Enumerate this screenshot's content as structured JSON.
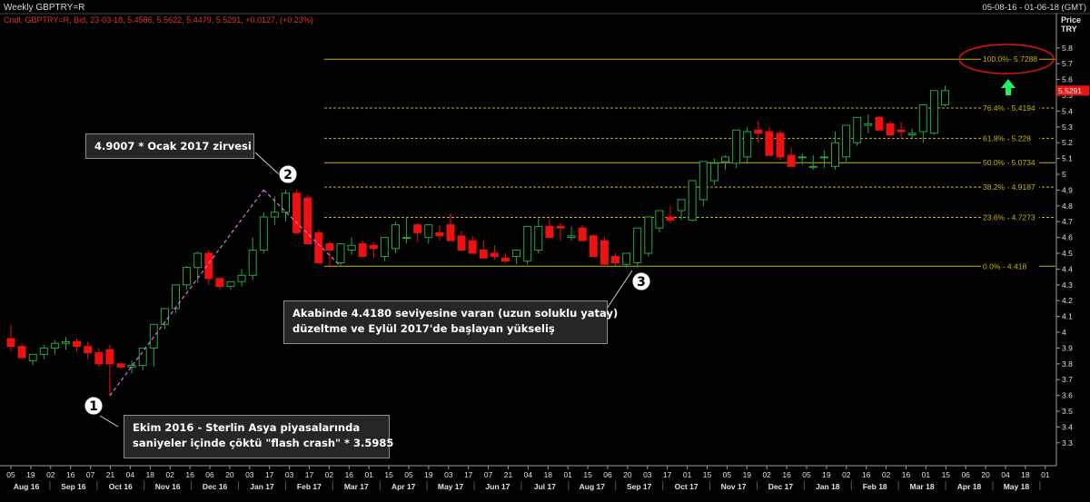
{
  "header": {
    "title": "Weekly GBPTRY=R",
    "date_range": "05-08-16 - 01-06-18 (GMT)",
    "legend_text": "Cndl, GBPTRY=R, Bid, 23-03-18, 5.4586, 5.5622, 5.4479, 5.5291, +0.0127, (+0.23%)",
    "legend_color": "#e2332b",
    "change_color": "#33d0ff"
  },
  "axis": {
    "unit_line1": "Price",
    "unit_line2": "TRY",
    "last_price_label": "5.5291",
    "y_ticks": [
      "5.8",
      "5.7",
      "5.6",
      "5.5",
      "5.4",
      "5.3",
      "5.2",
      "5.1",
      "5",
      "4.9",
      "4.8",
      "4.7",
      "4.6",
      "4.5",
      "4.4",
      "4.3",
      "4.2",
      "4.1",
      "4",
      "3.9",
      "3.8",
      "3.7",
      "3.6",
      "3.5",
      "3.4",
      "3.3"
    ],
    "x_day_ticks": [
      "05",
      "19",
      "02",
      "16",
      "07",
      "21",
      "04",
      "18",
      "02",
      "16",
      "06",
      "20",
      "03",
      "17",
      "03",
      "17",
      "02",
      "16",
      "01",
      "15",
      "05",
      "19",
      "03",
      "17",
      "07",
      "21",
      "04",
      "18",
      "01",
      "15",
      "06",
      "20",
      "03",
      "17",
      "01",
      "15",
      "05",
      "19",
      "02",
      "16",
      "05",
      "19",
      "02",
      "16",
      "02",
      "16",
      "01",
      "15",
      "06",
      "20",
      "04",
      "18",
      "01"
    ],
    "x_month_ticks": [
      "Aug 16",
      "Sep 16",
      "Oct 16",
      "Nov 16",
      "Dec 16",
      "Jan 17",
      "Feb 17",
      "Mar 17",
      "Apr 17",
      "May 17",
      "Jun 17",
      "Jul 17",
      "Aug 17",
      "Sep 17",
      "Oct 17",
      "Nov 17",
      "Dec 17",
      "Jan 18",
      "Feb 18",
      "Mar 18",
      "Apr 18",
      "May 18"
    ]
  },
  "fibonacci": [
    {
      "label": "100.0%- 5.7288"
    },
    {
      "label": "76.4% - 5.4194"
    },
    {
      "label": "61.8% - 5.228"
    },
    {
      "label": "50.0% - 5.0734"
    },
    {
      "label": "38.2% - 4.9187"
    },
    {
      "label": "23.6% - 4.7273"
    },
    {
      "label": "0.0% - 4.418"
    }
  ],
  "markers": [
    "1",
    "2",
    "3"
  ],
  "annotations": {
    "peak_line1": "4.9007 * Ocak 2017 zirvesi",
    "correction_line1": "Akabinde 4.4180 seviyesine varan (uzun soluklu yatay)",
    "correction_line2": "düzeltme ve Eylül 2017'de başlayan yükseliş",
    "crash_line1": "Ekim 2016 - Sterlin Asya piyasalarında",
    "crash_line2": "saniyeler içinde çöktü \"flash crash\" * 3.5985"
  },
  "colors": {
    "background": "#000000",
    "up": "#22a844",
    "down": "#ee1111",
    "fib": "#c8b400",
    "trend": "#e070e0",
    "arrow": "#22ee66",
    "circle": "#ee1111"
  },
  "chart_data": {
    "type": "candlestick",
    "title": "Weekly GBPTRY=R",
    "ylabel": "Price TRY",
    "ylim": [
      3.2,
      5.87
    ],
    "x_range": [
      "2016-08-05",
      "2018-06-01"
    ],
    "series": [
      {
        "name": "GBPTRY=R",
        "x": [
          "2016-08-05",
          "2016-08-12",
          "2016-08-19",
          "2016-08-26",
          "2016-09-02",
          "2016-09-09",
          "2016-09-16",
          "2016-09-23",
          "2016-09-30",
          "2016-10-07",
          "2016-10-14",
          "2016-10-21",
          "2016-10-28",
          "2016-11-04",
          "2016-11-11",
          "2016-11-18",
          "2016-11-25",
          "2016-12-02",
          "2016-12-09",
          "2016-12-16",
          "2016-12-23",
          "2016-12-30",
          "2017-01-06",
          "2017-01-13",
          "2017-01-20",
          "2017-01-27",
          "2017-02-03",
          "2017-02-10",
          "2017-02-17",
          "2017-02-24",
          "2017-03-03",
          "2017-03-10",
          "2017-03-17",
          "2017-03-24",
          "2017-03-31",
          "2017-04-07",
          "2017-04-14",
          "2017-04-21",
          "2017-04-28",
          "2017-05-05",
          "2017-05-12",
          "2017-05-19",
          "2017-05-26",
          "2017-06-02",
          "2017-06-09",
          "2017-06-16",
          "2017-06-23",
          "2017-06-30",
          "2017-07-07",
          "2017-07-14",
          "2017-07-21",
          "2017-07-28",
          "2017-08-04",
          "2017-08-11",
          "2017-08-18",
          "2017-08-25",
          "2017-09-01",
          "2017-09-08",
          "2017-09-15",
          "2017-09-22",
          "2017-09-29",
          "2017-10-06",
          "2017-10-13",
          "2017-10-20",
          "2017-10-27",
          "2017-11-03",
          "2017-11-10",
          "2017-11-17",
          "2017-11-24",
          "2017-12-01",
          "2017-12-08",
          "2017-12-15",
          "2017-12-22",
          "2017-12-29",
          "2018-01-05",
          "2018-01-12",
          "2018-01-19",
          "2018-01-26",
          "2018-02-02",
          "2018-02-09",
          "2018-02-16",
          "2018-02-23",
          "2018-03-02",
          "2018-03-09",
          "2018-03-16",
          "2018-03-23"
        ],
        "open": [
          3.96,
          3.91,
          3.82,
          3.86,
          3.9,
          3.93,
          3.94,
          3.91,
          3.87,
          3.89,
          3.8,
          3.78,
          3.79,
          3.9,
          4.05,
          4.15,
          4.3,
          4.41,
          4.5,
          4.34,
          4.29,
          4.32,
          4.36,
          4.52,
          4.73,
          4.76,
          4.88,
          4.85,
          4.63,
          4.56,
          4.44,
          4.52,
          4.56,
          4.55,
          4.48,
          4.53,
          4.6,
          4.68,
          4.6,
          4.63,
          4.68,
          4.61,
          4.58,
          4.52,
          4.5,
          4.47,
          4.48,
          4.45,
          4.52,
          4.67,
          4.67,
          4.6,
          4.66,
          4.61,
          4.58,
          4.48,
          4.43,
          4.44,
          4.5,
          4.66,
          4.73,
          4.77,
          4.71,
          4.84,
          4.96,
          5.08,
          5.07,
          5.11,
          5.28,
          5.27,
          5.26,
          5.12,
          5.11,
          5.05,
          5.11,
          5.05,
          5.11,
          5.2,
          5.31,
          5.36,
          5.32,
          5.28,
          5.25,
          5.27,
          5.26,
          5.44
        ],
        "high": [
          4.05,
          3.93,
          3.86,
          3.92,
          3.95,
          3.97,
          3.96,
          3.94,
          3.9,
          3.92,
          3.81,
          3.82,
          3.8,
          3.96,
          4.15,
          4.3,
          4.42,
          4.51,
          4.52,
          4.35,
          4.32,
          4.4,
          4.6,
          4.76,
          4.86,
          4.9,
          4.9,
          4.87,
          4.65,
          4.58,
          4.54,
          4.6,
          4.58,
          4.57,
          4.6,
          4.7,
          4.73,
          4.69,
          4.64,
          4.68,
          4.75,
          4.64,
          4.61,
          4.58,
          4.55,
          4.5,
          4.5,
          4.55,
          4.72,
          4.72,
          4.69,
          4.67,
          4.68,
          4.62,
          4.6,
          4.5,
          4.47,
          4.5,
          4.68,
          4.75,
          4.8,
          4.8,
          4.9,
          4.98,
          5.1,
          5.12,
          5.14,
          5.3,
          5.34,
          5.3,
          5.28,
          5.17,
          5.13,
          5.12,
          5.15,
          5.27,
          5.3,
          5.35,
          5.38,
          5.37,
          5.34,
          5.33,
          5.29,
          5.34,
          5.46,
          5.56
        ],
        "low": [
          3.88,
          3.83,
          3.79,
          3.83,
          3.86,
          3.89,
          3.88,
          3.83,
          3.78,
          3.6,
          3.77,
          3.74,
          3.76,
          3.78,
          4.02,
          4.12,
          4.27,
          4.31,
          4.3,
          4.27,
          4.27,
          4.29,
          4.33,
          4.5,
          4.68,
          4.7,
          4.62,
          4.6,
          4.52,
          4.42,
          4.42,
          4.49,
          4.49,
          4.47,
          4.45,
          4.5,
          4.56,
          4.57,
          4.56,
          4.58,
          4.58,
          4.57,
          4.51,
          4.48,
          4.46,
          4.44,
          4.43,
          4.43,
          4.5,
          4.6,
          4.58,
          4.58,
          4.58,
          4.57,
          4.44,
          4.42,
          4.41,
          4.41,
          4.48,
          4.63,
          4.69,
          4.71,
          4.7,
          4.8,
          4.93,
          5.03,
          5.04,
          5.07,
          5.2,
          5.23,
          5.09,
          5.08,
          5.06,
          5.03,
          5.04,
          5.03,
          5.08,
          5.18,
          5.26,
          5.3,
          5.24,
          5.23,
          5.23,
          5.2,
          5.25,
          5.43
        ],
        "close": [
          3.91,
          3.84,
          3.86,
          3.9,
          3.93,
          3.94,
          3.91,
          3.87,
          3.8,
          3.8,
          3.78,
          3.79,
          3.9,
          4.05,
          4.15,
          4.3,
          4.41,
          4.5,
          4.34,
          4.29,
          4.32,
          4.36,
          4.52,
          4.73,
          4.76,
          4.88,
          4.63,
          4.56,
          4.44,
          4.52,
          4.56,
          4.55,
          4.48,
          4.53,
          4.6,
          4.68,
          4.6,
          4.63,
          4.68,
          4.61,
          4.58,
          4.52,
          4.5,
          4.47,
          4.48,
          4.45,
          4.52,
          4.67,
          4.67,
          4.6,
          4.66,
          4.61,
          4.58,
          4.48,
          4.43,
          4.44,
          4.5,
          4.66,
          4.73,
          4.77,
          4.71,
          4.84,
          4.96,
          5.08,
          5.07,
          5.11,
          5.28,
          5.27,
          5.26,
          5.12,
          5.11,
          5.05,
          5.11,
          5.05,
          5.11,
          5.2,
          5.31,
          5.36,
          5.32,
          5.28,
          5.25,
          5.27,
          5.26,
          5.44,
          5.53,
          5.53
        ]
      }
    ],
    "fib_levels": [
      {
        "pct": "100.0%",
        "value": 5.7288
      },
      {
        "pct": "76.4%",
        "value": 5.4194
      },
      {
        "pct": "61.8%",
        "value": 5.228
      },
      {
        "pct": "50.0%",
        "value": 5.0734
      },
      {
        "pct": "38.2%",
        "value": 4.9187
      },
      {
        "pct": "23.6%",
        "value": 4.7273
      },
      {
        "pct": "0.0%",
        "value": 4.418
      }
    ],
    "trendlines": [
      {
        "from": [
          "2016-10-07",
          3.5985
        ],
        "to": [
          "2017-01-13",
          4.9007
        ]
      },
      {
        "from": [
          "2017-01-13",
          4.9007
        ],
        "to": [
          "2017-03-03",
          4.418
        ]
      }
    ],
    "grid": false
  }
}
